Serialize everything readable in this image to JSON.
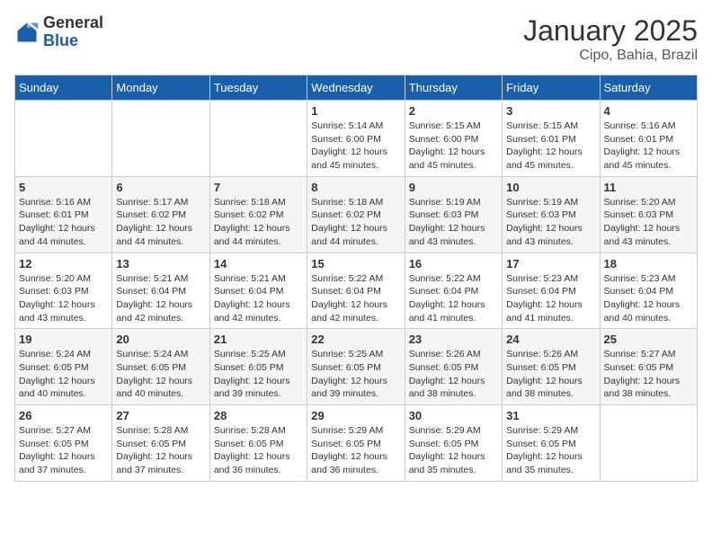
{
  "header": {
    "logo_general": "General",
    "logo_blue": "Blue",
    "title": "January 2025",
    "subtitle": "Cipo, Bahia, Brazil"
  },
  "weekdays": [
    "Sunday",
    "Monday",
    "Tuesday",
    "Wednesday",
    "Thursday",
    "Friday",
    "Saturday"
  ],
  "weeks": [
    [
      {
        "day": "",
        "info": ""
      },
      {
        "day": "",
        "info": ""
      },
      {
        "day": "",
        "info": ""
      },
      {
        "day": "1",
        "info": "Sunrise: 5:14 AM\nSunset: 6:00 PM\nDaylight: 12 hours\nand 45 minutes."
      },
      {
        "day": "2",
        "info": "Sunrise: 5:15 AM\nSunset: 6:00 PM\nDaylight: 12 hours\nand 45 minutes."
      },
      {
        "day": "3",
        "info": "Sunrise: 5:15 AM\nSunset: 6:01 PM\nDaylight: 12 hours\nand 45 minutes."
      },
      {
        "day": "4",
        "info": "Sunrise: 5:16 AM\nSunset: 6:01 PM\nDaylight: 12 hours\nand 45 minutes."
      }
    ],
    [
      {
        "day": "5",
        "info": "Sunrise: 5:16 AM\nSunset: 6:01 PM\nDaylight: 12 hours\nand 44 minutes."
      },
      {
        "day": "6",
        "info": "Sunrise: 5:17 AM\nSunset: 6:02 PM\nDaylight: 12 hours\nand 44 minutes."
      },
      {
        "day": "7",
        "info": "Sunrise: 5:18 AM\nSunset: 6:02 PM\nDaylight: 12 hours\nand 44 minutes."
      },
      {
        "day": "8",
        "info": "Sunrise: 5:18 AM\nSunset: 6:02 PM\nDaylight: 12 hours\nand 44 minutes."
      },
      {
        "day": "9",
        "info": "Sunrise: 5:19 AM\nSunset: 6:03 PM\nDaylight: 12 hours\nand 43 minutes."
      },
      {
        "day": "10",
        "info": "Sunrise: 5:19 AM\nSunset: 6:03 PM\nDaylight: 12 hours\nand 43 minutes."
      },
      {
        "day": "11",
        "info": "Sunrise: 5:20 AM\nSunset: 6:03 PM\nDaylight: 12 hours\nand 43 minutes."
      }
    ],
    [
      {
        "day": "12",
        "info": "Sunrise: 5:20 AM\nSunset: 6:03 PM\nDaylight: 12 hours\nand 43 minutes."
      },
      {
        "day": "13",
        "info": "Sunrise: 5:21 AM\nSunset: 6:04 PM\nDaylight: 12 hours\nand 42 minutes."
      },
      {
        "day": "14",
        "info": "Sunrise: 5:21 AM\nSunset: 6:04 PM\nDaylight: 12 hours\nand 42 minutes."
      },
      {
        "day": "15",
        "info": "Sunrise: 5:22 AM\nSunset: 6:04 PM\nDaylight: 12 hours\nand 42 minutes."
      },
      {
        "day": "16",
        "info": "Sunrise: 5:22 AM\nSunset: 6:04 PM\nDaylight: 12 hours\nand 41 minutes."
      },
      {
        "day": "17",
        "info": "Sunrise: 5:23 AM\nSunset: 6:04 PM\nDaylight: 12 hours\nand 41 minutes."
      },
      {
        "day": "18",
        "info": "Sunrise: 5:23 AM\nSunset: 6:04 PM\nDaylight: 12 hours\nand 40 minutes."
      }
    ],
    [
      {
        "day": "19",
        "info": "Sunrise: 5:24 AM\nSunset: 6:05 PM\nDaylight: 12 hours\nand 40 minutes."
      },
      {
        "day": "20",
        "info": "Sunrise: 5:24 AM\nSunset: 6:05 PM\nDaylight: 12 hours\nand 40 minutes."
      },
      {
        "day": "21",
        "info": "Sunrise: 5:25 AM\nSunset: 6:05 PM\nDaylight: 12 hours\nand 39 minutes."
      },
      {
        "day": "22",
        "info": "Sunrise: 5:25 AM\nSunset: 6:05 PM\nDaylight: 12 hours\nand 39 minutes."
      },
      {
        "day": "23",
        "info": "Sunrise: 5:26 AM\nSunset: 6:05 PM\nDaylight: 12 hours\nand 38 minutes."
      },
      {
        "day": "24",
        "info": "Sunrise: 5:26 AM\nSunset: 6:05 PM\nDaylight: 12 hours\nand 38 minutes."
      },
      {
        "day": "25",
        "info": "Sunrise: 5:27 AM\nSunset: 6:05 PM\nDaylight: 12 hours\nand 38 minutes."
      }
    ],
    [
      {
        "day": "26",
        "info": "Sunrise: 5:27 AM\nSunset: 6:05 PM\nDaylight: 12 hours\nand 37 minutes."
      },
      {
        "day": "27",
        "info": "Sunrise: 5:28 AM\nSunset: 6:05 PM\nDaylight: 12 hours\nand 37 minutes."
      },
      {
        "day": "28",
        "info": "Sunrise: 5:28 AM\nSunset: 6:05 PM\nDaylight: 12 hours\nand 36 minutes."
      },
      {
        "day": "29",
        "info": "Sunrise: 5:29 AM\nSunset: 6:05 PM\nDaylight: 12 hours\nand 36 minutes."
      },
      {
        "day": "30",
        "info": "Sunrise: 5:29 AM\nSunset: 6:05 PM\nDaylight: 12 hours\nand 35 minutes."
      },
      {
        "day": "31",
        "info": "Sunrise: 5:29 AM\nSunset: 6:05 PM\nDaylight: 12 hours\nand 35 minutes."
      },
      {
        "day": "",
        "info": ""
      }
    ]
  ]
}
